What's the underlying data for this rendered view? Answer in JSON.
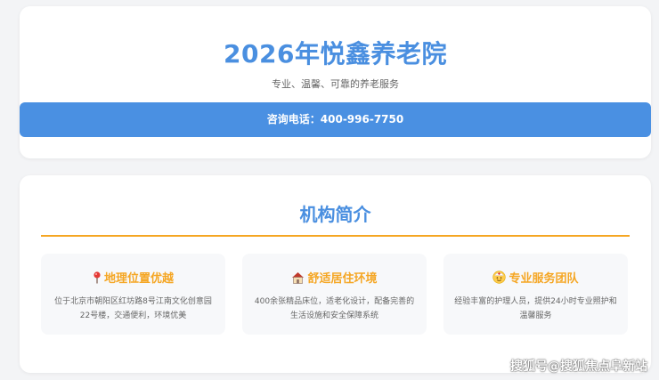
{
  "hero": {
    "title": "2026年悦鑫养老院",
    "subtitle": "专业、温馨、可靠的养老服务",
    "phone": "咨询电话：400-996-7750"
  },
  "intro": {
    "title": "机构简介",
    "features": [
      {
        "icon": "pin-icon",
        "title": "地理位置优越",
        "desc": "位于北京市朝阳区红坊路8号江南文化创意园22号楼，交通便利，环境优美"
      },
      {
        "icon": "house-icon",
        "title": "舒适居住环境",
        "desc": "400余张精品床位，适老化设计，配备完善的生活设施和安全保障系统"
      },
      {
        "icon": "team-icon",
        "title": "专业服务团队",
        "desc": "经验丰富的护理人员，提供24小时专业照护和温馨服务"
      }
    ]
  },
  "watermark": "搜狐号@搜狐焦点阜新站",
  "colors": {
    "accent_blue": "#4a90e2",
    "accent_orange": "#f5a623"
  }
}
